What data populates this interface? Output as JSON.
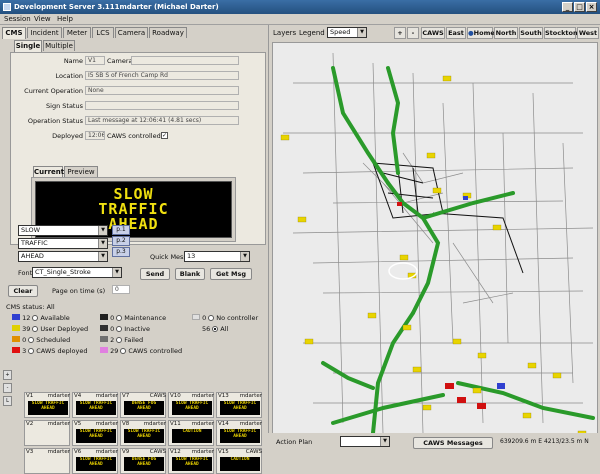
{
  "window": {
    "title": "Development Server 3.111mdarter (Michael Darter)"
  },
  "menu": [
    {
      "label": "Session"
    },
    {
      "label": "View"
    },
    {
      "label": "Help"
    }
  ],
  "left_tabs": [
    {
      "label": "CMS"
    },
    {
      "label": "Incident"
    },
    {
      "label": "Meter"
    },
    {
      "label": "LCS"
    },
    {
      "label": "Camera"
    },
    {
      "label": "Roadway"
    }
  ],
  "sub_tabs": [
    {
      "label": "Single"
    },
    {
      "label": "Multiple"
    }
  ],
  "device": {
    "name_label": "Name",
    "name": "V1",
    "camera_label": "Camera",
    "camera": "",
    "location_label": "Location",
    "location": "I5 SB S of French Camp Rd",
    "current_op_label": "Current Operation",
    "current_op": "None",
    "sign_status_label": "Sign Status",
    "sign_status": "",
    "op_status_label": "Operation Status",
    "op_status": "Last message at 12:06:41 (4.81 secs)",
    "deployed_label": "Deployed",
    "deployed": "12:06",
    "caws_controlled_label": "CAWS controlled"
  },
  "preview_tabs": [
    {
      "label": "Current"
    },
    {
      "label": "Preview"
    }
  ],
  "sign_message": {
    "line1": "SLOW",
    "line2": "TRAFFIC",
    "line3": "AHEAD"
  },
  "compose": {
    "lines": [
      "SLOW",
      "TRAFFIC",
      "AHEAD"
    ],
    "pages": [
      "p.1",
      "p.2",
      "p.3"
    ],
    "font_label": "Font",
    "font": "CT_Single_Stroke",
    "clear_label": "Clear",
    "pages_on_time_label": "Page on time (s)",
    "pages_on_time": "0",
    "quick_message_label": "Quick Message",
    "quick_message": "13",
    "send_label": "Send",
    "blank_label": "Blank",
    "getmsg_label": "Get Msg"
  },
  "cms_status": {
    "title": "CMS status: All",
    "rows": [
      {
        "count": "12",
        "label": "Available",
        "color": "#3040d0"
      },
      {
        "count": "39",
        "label": "User Deployed",
        "color": "#e0d000"
      },
      {
        "count": "0",
        "label": "Scheduled",
        "color": "#e09000"
      },
      {
        "count": "3",
        "label": "CAWS deployed",
        "color": "#e01010"
      }
    ],
    "rows2": [
      {
        "count": "0",
        "label": "Maintenance",
        "color": "#202020"
      },
      {
        "count": "0",
        "label": "Inactive",
        "color": "#303030"
      },
      {
        "count": "2",
        "label": "Failed",
        "color": "#707070"
      },
      {
        "count": "29",
        "label": "CAWS controlled",
        "color": "#e080e0"
      }
    ],
    "rows3": [
      {
        "count": "0",
        "label": "No controller"
      },
      {
        "count": "56",
        "label": "All"
      }
    ]
  },
  "thumbnails": [
    {
      "id": "V1",
      "user": "mdarter",
      "msg": "SLOW TRAFFIC AHEAD"
    },
    {
      "id": "V4",
      "user": "mdarter",
      "msg": "SLOW TRAFFIC AHEAD"
    },
    {
      "id": "V7",
      "user": "CAWS",
      "msg": "DENSE FOG AHEAD"
    },
    {
      "id": "V10",
      "user": "mdarter",
      "msg": "SLOW TRAFFIC AHEAD"
    },
    {
      "id": "V13",
      "user": "mdarter",
      "msg": "SLOW TRAFFIC AHEAD"
    },
    {
      "id": "V2",
      "user": "mdarter",
      "msg": ""
    },
    {
      "id": "V5",
      "user": "mdarter",
      "msg": "SLOW TRAFFIC AHEAD"
    },
    {
      "id": "V8",
      "user": "mdarter",
      "msg": "SLOW TRAFFIC AHEAD"
    },
    {
      "id": "V11",
      "user": "mdarter",
      "msg": "CAUTION"
    },
    {
      "id": "V14",
      "user": "mdarter",
      "msg": "SLOW TRAFFIC AHEAD"
    },
    {
      "id": "V3",
      "user": "mdarter",
      "msg": ""
    },
    {
      "id": "V6",
      "user": "mdarter",
      "msg": "SLOW TRAFFIC AHEAD"
    },
    {
      "id": "V9",
      "user": "CAWS",
      "msg": "DENSE FOG AHEAD"
    },
    {
      "id": "V12",
      "user": "mdarter",
      "msg": "SLOW TRAFFIC AHEAD"
    },
    {
      "id": "V15",
      "user": "CAWS",
      "msg": "CAUTION"
    }
  ],
  "side_buttons": [
    "+",
    "-",
    "L"
  ],
  "map_toolbar": {
    "layers": "Layers",
    "legend": "Legend",
    "theme": "Speed",
    "zoom_in": "+",
    "zoom_out": "-",
    "buttons": [
      "CAWS",
      "East",
      "Home",
      "North",
      "South",
      "Stockton",
      "West"
    ]
  },
  "bottom": {
    "action_plan_label": "Action Plan",
    "action_plan": "",
    "caws_messages": "CAWS Messages",
    "coords": "639209.6 m E 4213/23.5 m N"
  }
}
